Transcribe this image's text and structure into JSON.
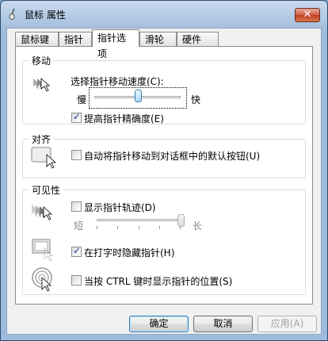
{
  "window": {
    "title": "鼠标 属性",
    "close_glyph": "✕"
  },
  "tabs": [
    {
      "label": "鼠标键"
    },
    {
      "label": "指针"
    },
    {
      "label": "指针选项",
      "active": true
    },
    {
      "label": "滑轮"
    },
    {
      "label": "硬件"
    }
  ],
  "motion": {
    "group_label": "移动",
    "speed_label": "选择指针移动速度(C):",
    "slow": "慢",
    "fast": "快",
    "speed_value": 0.5,
    "precision_label": "提高指针精确度(E)",
    "precision_checked": true
  },
  "snap": {
    "group_label": "对齐",
    "label": "自动将指针移动到对话框中的默认按钮(U)",
    "checked": false
  },
  "visibility": {
    "group_label": "可见性",
    "trails_label": "显示指针轨迹(D)",
    "trails_checked": false,
    "short": "短",
    "long": "长",
    "trail_value": 1.0,
    "hide_label": "在打字时隐藏指针(H)",
    "hide_checked": true,
    "ctrl_label": "当按 CTRL 键时显示指针的位置(S)",
    "ctrl_checked": false
  },
  "buttons": {
    "ok": "确定",
    "cancel": "取消",
    "apply": "应用(A)"
  },
  "colors": {
    "accent": "#3c7fb1",
    "title_bar": "#a9c2e0",
    "close": "#c03c22"
  }
}
